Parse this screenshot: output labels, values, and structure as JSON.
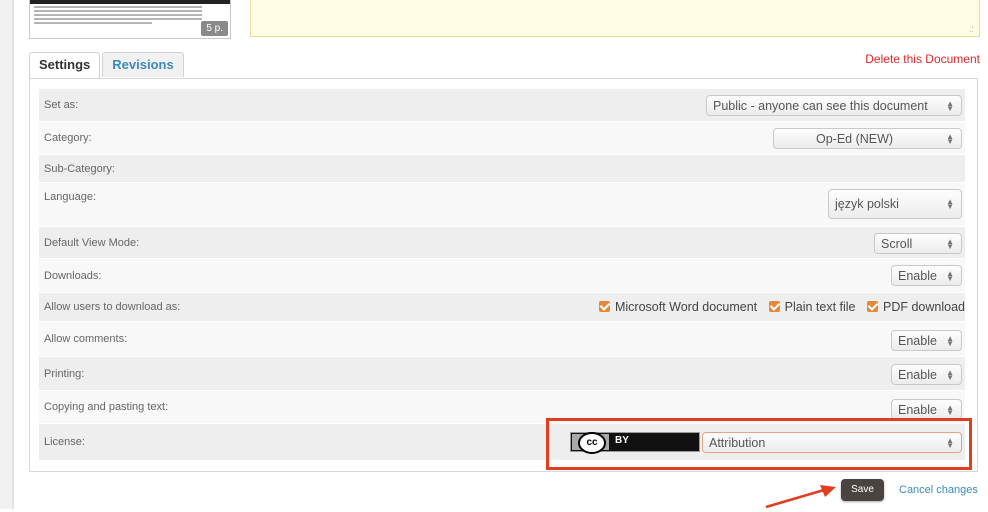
{
  "document": {
    "page_count": "5 p.",
    "grip_icon": ".:"
  },
  "tabs": [
    {
      "label": "Settings",
      "active": true
    },
    {
      "label": "Revisions",
      "active": false
    }
  ],
  "delete_label": "Delete this Document",
  "settings": {
    "set_as": {
      "label": "Set as:",
      "value": "Public - anyone can see this document"
    },
    "category": {
      "label": "Category:",
      "value": "Op-Ed (NEW)"
    },
    "sub_category": {
      "label": "Sub-Category:"
    },
    "language": {
      "label": "Language:",
      "value": "język polski"
    },
    "view_mode": {
      "label": "Default View Mode:",
      "value": "Scroll"
    },
    "downloads": {
      "label": "Downloads:",
      "value": "Enable"
    },
    "download_as": {
      "label": "Allow users to download as:",
      "options": [
        {
          "label": "Microsoft Word document",
          "checked": true
        },
        {
          "label": "Plain text file",
          "checked": true
        },
        {
          "label": "PDF download",
          "checked": true
        }
      ]
    },
    "comments": {
      "label": "Allow comments:",
      "value": "Enable"
    },
    "printing": {
      "label": "Printing:",
      "value": "Enable"
    },
    "copying": {
      "label": "Copying and pasting text:",
      "value": "Enable"
    },
    "license": {
      "label": "License:",
      "badge_cc": "cc",
      "badge_by": "BY",
      "value": "Attribution"
    }
  },
  "actions": {
    "save_label": "Save",
    "cancel_label": "Cancel changes"
  },
  "colors": {
    "accent_link": "#3b8bb8",
    "delete_red": "#e2262a",
    "highlight_red": "#e23d21",
    "checkbox_orange": "#e08a3a"
  }
}
